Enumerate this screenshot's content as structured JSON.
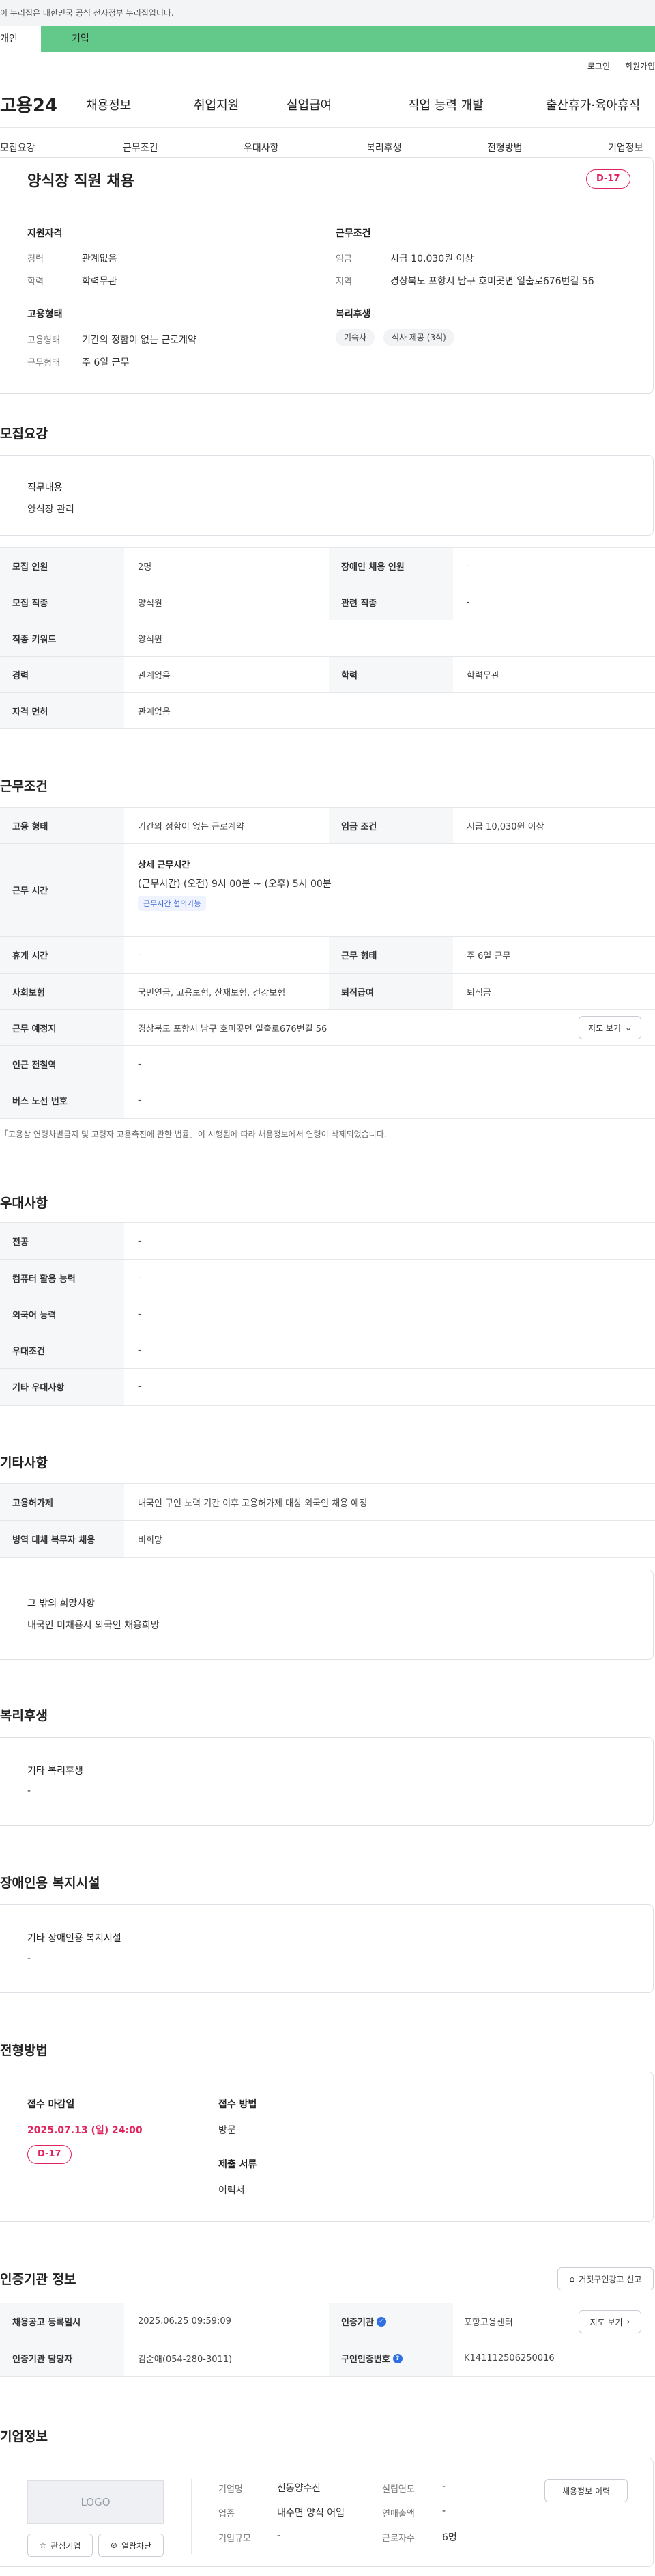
{
  "gov_banner": "이 누리집은 대한민국 공식 전자정부 누리집입니다.",
  "top_tabs": [
    "개인",
    "기업"
  ],
  "util": [
    "로그인",
    "회원가입"
  ],
  "logo": "고용24",
  "gnb": [
    "채용정보",
    "취업지원",
    "실업급여",
    "직업 능력 개발",
    "출산휴가·육아휴직"
  ],
  "anchors": [
    "모집요강",
    "근무조건",
    "우대사항",
    "복리후생",
    "전형방법",
    "기업정보"
  ],
  "summary": {
    "title": "양식장 직원 채용",
    "dday": "D-17",
    "qual_title": "지원자격",
    "qual": [
      {
        "k": "경력",
        "v": "관계없음"
      },
      {
        "k": "학력",
        "v": "학력무관"
      }
    ],
    "emp_title": "고용형태",
    "emp": [
      {
        "k": "고용형태",
        "v": "기간의 정함이 없는 근로계약"
      },
      {
        "k": "근무형태",
        "v": "주 6일 근무"
      }
    ],
    "cond_title": "근무조건",
    "cond": [
      {
        "k": "임금",
        "v": "시급 10,030원 이상"
      },
      {
        "k": "지역",
        "v": "경상북도 포항시 남구 호미곶면 일출로676번길 56"
      }
    ],
    "welfare_title": "복리후생",
    "welfare_chips": [
      "기숙사",
      "식사 제공 (3식)"
    ]
  },
  "recruit": {
    "title": "모집요강",
    "duty_label": "직무내용",
    "duty_value": "양식장 관리",
    "rows": [
      {
        "k1": "모집 인원",
        "v1": "2명",
        "k2": "장애인 채용 인원",
        "v2": "-"
      },
      {
        "k1": "모집 직종",
        "v1": "양식원",
        "k2": "관련 직종",
        "v2": "-"
      },
      {
        "k1": "직종 키워드",
        "v1": "양식원",
        "k2": "",
        "v2": ""
      },
      {
        "k1": "경력",
        "v1": "관계없음",
        "k2": "학력",
        "v2": "학력무관"
      },
      {
        "k1": "자격 면허",
        "v1": "관계없음",
        "k2": "",
        "v2": ""
      }
    ]
  },
  "work": {
    "title": "근무조건",
    "r1": {
      "k1": "고용 형태",
      "v1": "기간의 정함이 없는 근로계약",
      "k2": "임금 조건",
      "v2": "시급 10,030원 이상"
    },
    "hours_label": "근무 시간",
    "hours_title": "상세 근무시간",
    "hours_value": "(근무시간) (오전) 9시 00분 ~ (오후) 5시 00분",
    "hours_badge": "근무시간 협의가능",
    "r3": {
      "k1": "휴게 시간",
      "v1": "-",
      "k2": "근무 형태",
      "v2": "주 6일 근무"
    },
    "r4": {
      "k1": "사회보험",
      "v1": "국민연금, 고용보험, 산재보험, 건강보험",
      "k2": "퇴직급여",
      "v2": "퇴직금"
    },
    "r5": {
      "k1": "근무 예정지",
      "v1": "경상북도 포항시 남구 호미곶면 일출로676번길 56",
      "btn": "지도 보기"
    },
    "r6": {
      "k1": "인근 전철역",
      "v1": "-"
    },
    "r7": {
      "k1": "버스 노선 번호",
      "v1": "-"
    },
    "note": "「고용상 연령차별금지 및 고령자 고용촉진에 관한 법률」이 시행됨에 따라 채용정보에서 연령이 삭제되었습니다."
  },
  "prefer": {
    "title": "우대사항",
    "rows": [
      {
        "k": "전공",
        "v": "-"
      },
      {
        "k": "컴퓨터 활용 능력",
        "v": "-"
      },
      {
        "k": "외국어 능력",
        "v": "-"
      },
      {
        "k": "우대조건",
        "v": "-"
      },
      {
        "k": "기타 우대사항",
        "v": "-"
      }
    ]
  },
  "etc": {
    "title": "기타사항",
    "rows": [
      {
        "k": "고용허가제",
        "v": "내국인 구인 노력 기간 이후 고용허가제 대상 외국인 채용 예정"
      },
      {
        "k": "병역 대체 복무자 채용",
        "v": "비희망"
      }
    ],
    "box_title": "그 밖의 희망사항",
    "box_value": "내국인 미채용시 외국인 채용희망"
  },
  "benefit": {
    "title": "복리후생",
    "box_title": "기타 복리후생",
    "box_value": "-"
  },
  "disabled": {
    "title": "장애인용 복지시설",
    "box_title": "기타 장애인용 복지시설",
    "box_value": "-"
  },
  "process": {
    "title": "전형방법",
    "deadline_label": "접수 마감일",
    "deadline": "2025.07.13 (일) 24:00",
    "dday": "D-17",
    "method_label": "접수 방법",
    "method": "방문",
    "docs_label": "제출 서류",
    "docs": "이력서"
  },
  "cert": {
    "title": "인증기관 정보",
    "report_btn": "거짓구인광고 신고",
    "r1": {
      "k1": "채용공고 등록일시",
      "v1": "2025.06.25 09:59:09",
      "k2": "인증기관",
      "v2": "포항고용센터",
      "btn": "지도 보기"
    },
    "r2": {
      "k1": "인증기관 담당자",
      "v1": "김순애(054-280-3011)",
      "k2": "구인인증번호",
      "v2": "K141112506250016"
    }
  },
  "company": {
    "title": "기업정보",
    "logo_text": "LOGO",
    "fav_btn": "관심기업",
    "block_btn": "열람차단",
    "fields": [
      {
        "k": "기업명",
        "v": "신동양수산"
      },
      {
        "k": "업종",
        "v": "내수면 양식 어업"
      },
      {
        "k": "기업규모",
        "v": "-"
      },
      {
        "k": "설립연도",
        "v": "-"
      },
      {
        "k": "연매출액",
        "v": "-"
      },
      {
        "k": "근로자수",
        "v": "6명"
      }
    ],
    "history_btn": "채용정보 이력"
  },
  "colors": {
    "accent_green": "#62c98a",
    "dday_red": "#e0245e",
    "link_blue": "#2f6fe4"
  }
}
